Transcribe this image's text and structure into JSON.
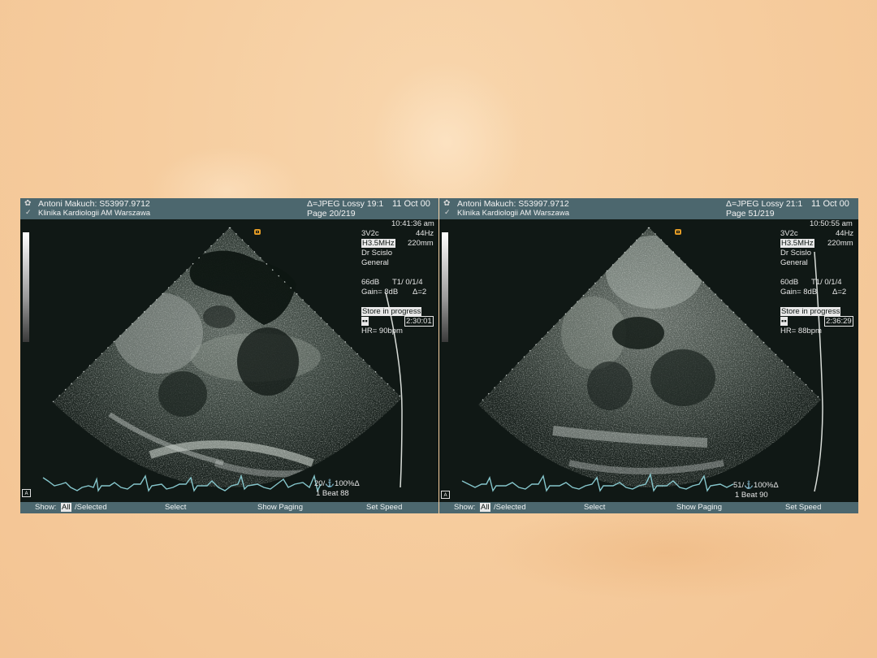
{
  "panels": [
    {
      "patient": "Antoni Makuch: S53997.9712",
      "clinic": "Klinika Kardiologii AM Warszawa",
      "compression": "Δ=JPEG Lossy 19:1",
      "page": "Page 20/219",
      "date": "11 Oct 00",
      "time": "10:41:36 am",
      "probe": "3V2c",
      "framerate": "44Hz",
      "frequency": "H3.5MHz",
      "depth": "220mm",
      "doctor": "Dr Scislo",
      "preset": "General",
      "power": "66dB",
      "mode": "T1/  0/1/4",
      "gain": "Gain=  8dB",
      "delta": "Δ=2",
      "store": "Store in progress",
      "store_icon": "▪▪",
      "store_time": "2:30:01",
      "hr": "HR=  90bpm",
      "frame": "20/⚓100%Δ",
      "beat": "1 Beat 88",
      "footer": {
        "show": "Show:",
        "all": "All",
        "selected": "/Selected",
        "select": "Select",
        "paging": "Show Paging",
        "speed": "Set Speed"
      }
    },
    {
      "patient": "Antoni Makuch: S53997.9712",
      "clinic": "Klinika Kardiologii AM Warszawa",
      "compression": "Δ=JPEG Lossy 21:1",
      "page": "Page 51/219",
      "date": "11 Oct 00",
      "time": "10:50:55 am",
      "probe": "3V2c",
      "framerate": "44Hz",
      "frequency": "H3.5MHz",
      "depth": "220mm",
      "doctor": "Dr Scislo",
      "preset": "General",
      "power": "60dB",
      "mode": "T1/  0/1/4",
      "gain": "Gain=  8dB",
      "delta": "Δ=2",
      "store": "Store in progress",
      "store_icon": "▪▪",
      "store_time": "2:36:29",
      "hr": "HR=  88bpm",
      "frame": "51/⚓100%Δ",
      "beat": "1 Beat 90",
      "footer": {
        "show": "Show:",
        "all": "All",
        "selected": "/Selected",
        "select": "Select",
        "paging": "Show Paging",
        "speed": "Set Speed"
      }
    }
  ],
  "colors": {
    "header": "#4c676e",
    "screen": "#101815",
    "marker": "#e39b25",
    "background": "#f6cd9f"
  },
  "icons": [
    "gear-icon",
    "checkmark-icon",
    "grayscale-bar",
    "orientation-marker-icon",
    "annotation-icon"
  ]
}
